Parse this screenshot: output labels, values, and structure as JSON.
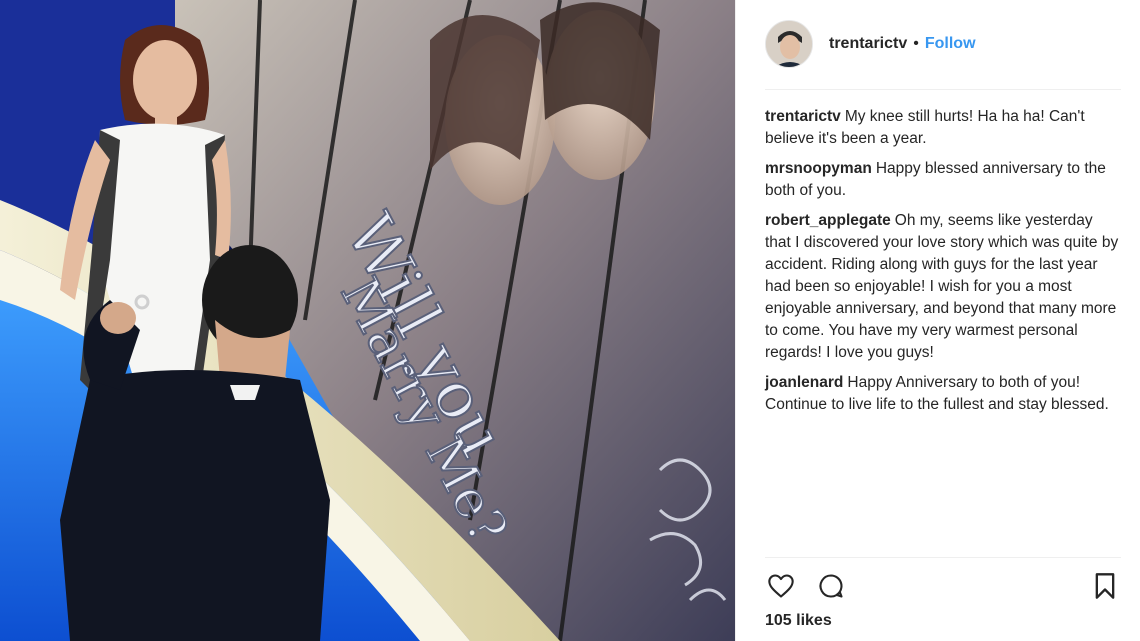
{
  "header": {
    "username": "trentarictv",
    "separator": "•",
    "follow_label": "Follow"
  },
  "photo": {
    "banner_line_1": "Will you",
    "banner_line_2": "Marry Me?"
  },
  "comments": [
    {
      "user": "trentarictv",
      "text": "My knee still hurts! Ha ha ha! Can't believe it's been a year."
    },
    {
      "user": "mrsnoopyman",
      "text": "Happy blessed anniversary to the both of you."
    },
    {
      "user": "robert_applegate",
      "text": "Oh my, seems like yesterday that I discovered your love story which was quite by accident. Riding along with guys for the last year had been so enjoyable! I wish for you a most enjoyable anniversary, and beyond that many more to come. You have my very warmest personal regards! I love you guys!"
    },
    {
      "user": "joanlenard",
      "text": "Happy Anniversary to both of you! Continue to live life to the fullest and stay blessed."
    }
  ],
  "actions": {
    "like_icon": "heart-icon",
    "comment_icon": "comment-icon",
    "save_icon": "bookmark-icon"
  },
  "likes_label": "105 likes",
  "colors": {
    "link_blue": "#3897f0",
    "text": "#262626",
    "divider": "#efefef"
  }
}
